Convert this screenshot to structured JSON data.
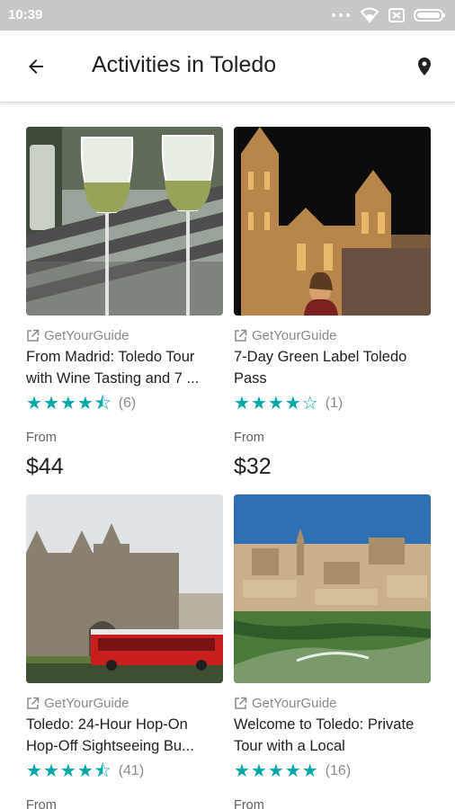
{
  "status_bar": {
    "time": "10:39"
  },
  "app_bar": {
    "title": "Activities in Toledo"
  },
  "activities": [
    {
      "provider": "GetYourGuide",
      "title": "From Madrid: Toledo Tour with Wine Tasting and 7 ...",
      "rating": 4.5,
      "reviews": "(6)",
      "from_label": "From",
      "price": "$44"
    },
    {
      "provider": "GetYourGuide",
      "title": "7-Day Green Label Toledo Pass",
      "rating": 4,
      "reviews": "(1)",
      "from_label": "From",
      "price": "$32"
    },
    {
      "provider": "GetYourGuide",
      "title": "Toledo: 24-Hour Hop-On Hop-Off Sightseeing Bu...",
      "rating": 4.5,
      "reviews": "(41)",
      "from_label": "From",
      "price": ""
    },
    {
      "provider": "GetYourGuide",
      "title": "Welcome to Toledo: Private Tour with a Local",
      "rating": 5,
      "reviews": "(16)",
      "from_label": "From",
      "price": ""
    }
  ],
  "colors": {
    "accent_teal": "#00a7a7",
    "status_bar": "#c7c7c7"
  },
  "icons": [
    "back-arrow-icon",
    "map-pin-icon",
    "external-link-icon",
    "star-icon",
    "wifi-icon",
    "signal-icon",
    "battery-icon"
  ]
}
